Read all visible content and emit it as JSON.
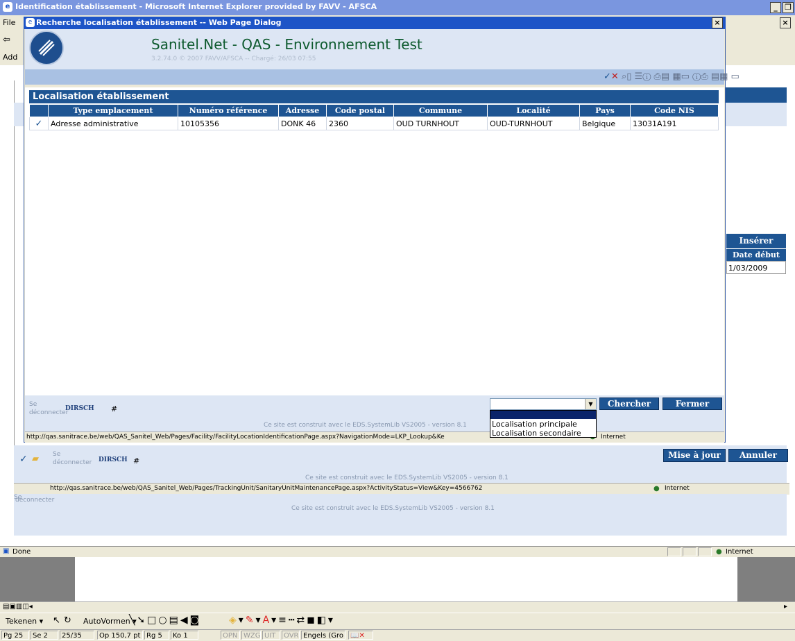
{
  "ie_window": {
    "title": "Identification établissement - Microsoft Internet Explorer provided by FAVV - AFSCA",
    "menu_left": "File",
    "toolbar_left": "⇦",
    "address_left": "Add",
    "status_done": "Done",
    "status_zone": "Internet"
  },
  "background_page": {
    "insert_button": "Insérer",
    "date_col_header": "Date début",
    "date_value": "1/03/2009",
    "update_button": "Mise à jour",
    "cancel_button": "Annuler",
    "logout_1": "Se",
    "logout_2": "déconnecter",
    "user": "DIRSCH",
    "hash": "#",
    "footer_text": "Ce site est construit avec le EDS.SystemLib VS2005 - version 8.1",
    "status_url": "http://qas.sanitrace.be/web/QAS_Sanitel_Web/Pages/TrackingUnit/SanitaryUnitMaintenancePage.aspx?ActivityStatus=View&Key=4566762",
    "status_zone": "Internet",
    "outer_logout_1": "Se",
    "outer_logout_2": "déconnecter",
    "outer_footer_text": "Ce site est construit avec le EDS.SystemLib VS2005 - version 8.1"
  },
  "dialog": {
    "title": "Recherche localisation établissement -- Web Page Dialog",
    "close_glyph": "×",
    "app_title": "Sanitel.Net - QAS - Environnement Test",
    "app_version": "3.2.74.0 © 2007 FAVV/AFSCA -- Chargé: 26/03 07:55",
    "panel_title": "Localisation établissement",
    "columns": [
      "Type emplacement",
      "Numéro référence",
      "Adresse",
      "Code postal",
      "Commune",
      "Localité",
      "Pays",
      "Code NIS"
    ],
    "rows": [
      {
        "check": "✓",
        "cells": [
          "Adresse administrative",
          "10105356",
          "DONK 46",
          "2360",
          "OUD TURNHOUT",
          "OUD-TURNHOUT",
          "Belgique",
          "13031A191"
        ]
      }
    ],
    "logout_1": "Se",
    "logout_2": "déconnecter",
    "user": "DIRSCH",
    "hash": "#",
    "search_button": "Chercher",
    "close_button": "Fermer",
    "dropdown_options": [
      "",
      "Localisation principale",
      "Localisation secondaire"
    ],
    "footer_text": "Ce site est construit avec le EDS.SystemLib VS2005 - version 8.1",
    "status_url": "http://qas.sanitrace.be/web/QAS_Sanitel_Web/Pages/Facility/FacilityLocationIdentificationPage.aspx?NavigationMode=LKP_Lookup&Ke",
    "status_zone": "Internet"
  },
  "word": {
    "draw_menu": "Tekenen ▾",
    "autoshapes": "AutoVormen ▾",
    "status": [
      "Pg 25",
      "Se 2",
      "25/35",
      "Op 150,7 pt",
      "Rg 5",
      "Ko 1",
      "OPN",
      "WZG",
      "UIT",
      "OVR",
      "Engels (Gro"
    ]
  },
  "colors": {
    "navy": "#1e5593",
    "title_green": "#0d5a2e",
    "dialog_title_blue": "#1d54c7"
  }
}
